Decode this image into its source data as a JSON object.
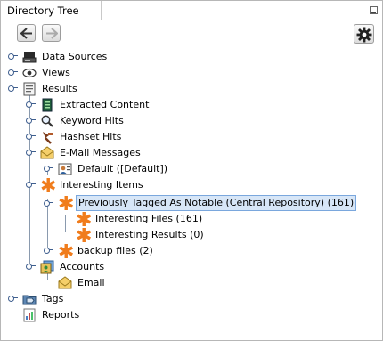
{
  "panel": {
    "title": "Directory Tree"
  },
  "tree": {
    "data_sources": "Data Sources",
    "views": "Views",
    "results": "Results",
    "extracted_content": "Extracted Content",
    "keyword_hits": "Keyword Hits",
    "hashset_hits": "Hashset Hits",
    "email_messages": "E-Mail Messages",
    "email_default": "Default ([Default])",
    "interesting_items": "Interesting Items",
    "prev_tagged": "Previously Tagged As Notable (Central Repository) (161)",
    "interesting_files": "Interesting Files (161)",
    "interesting_results": "Interesting Results (0)",
    "backup_files": "backup files (2)",
    "accounts": "Accounts",
    "email": "Email",
    "tags": "Tags",
    "reports": "Reports"
  },
  "colors": {
    "selection_bg": "#d7e6f7",
    "selection_border": "#7aa7dd",
    "asterisk": "#f07c1c"
  }
}
